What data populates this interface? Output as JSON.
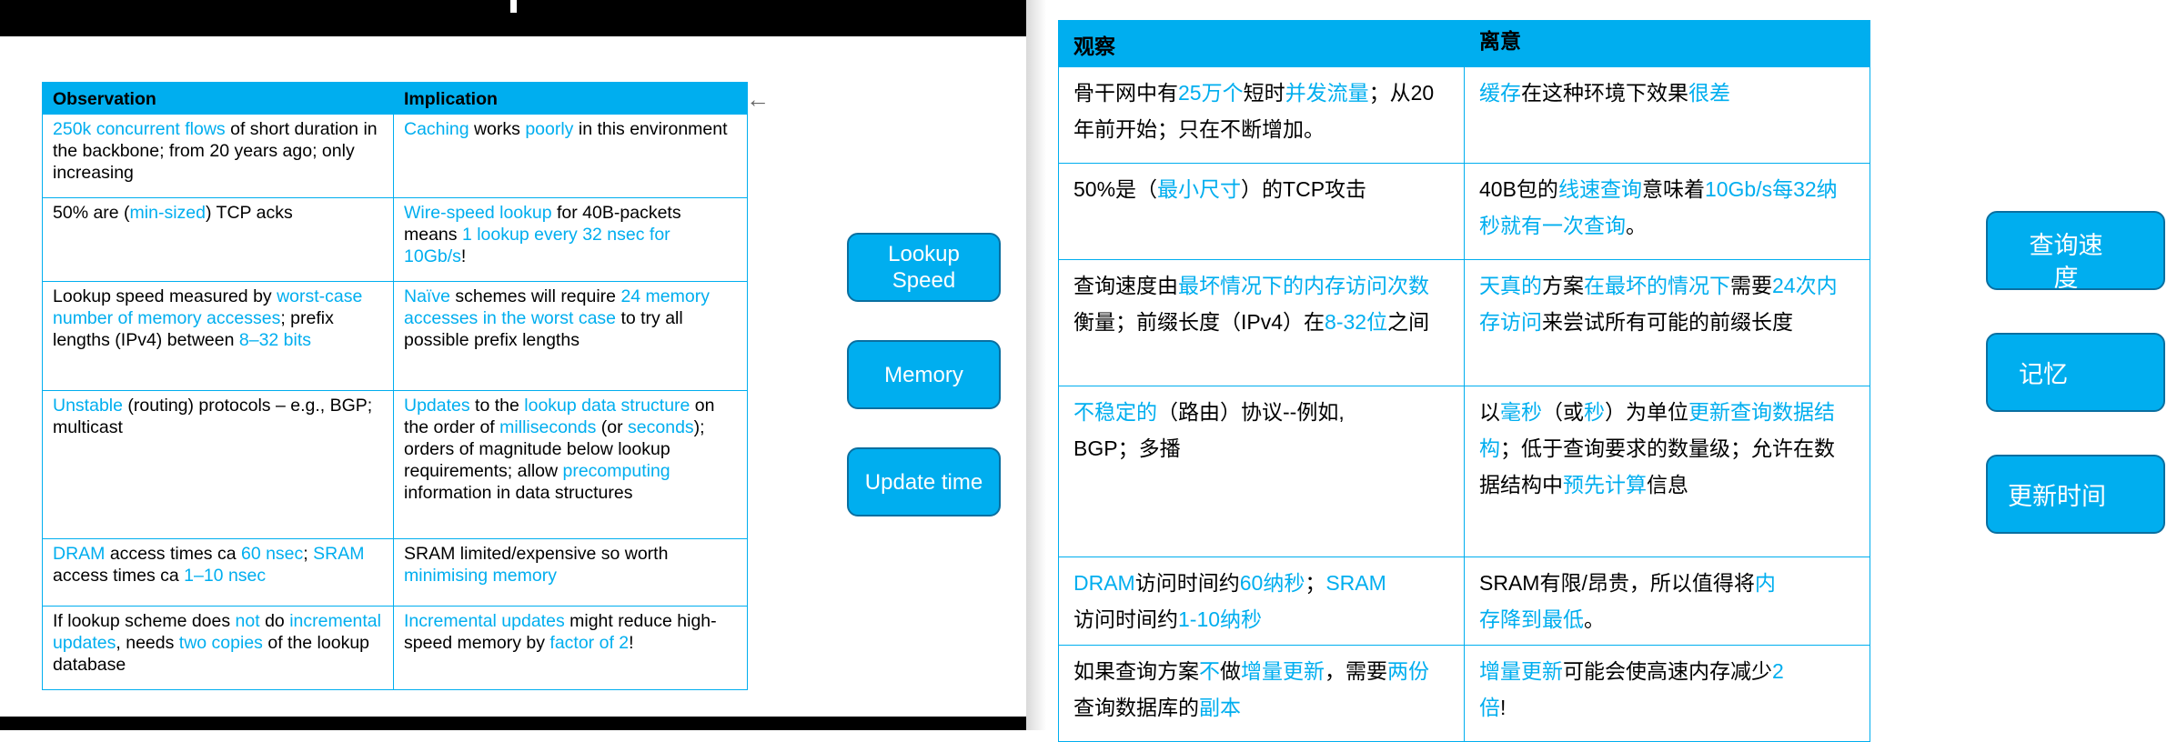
{
  "left_slide": {
    "headers": {
      "observation": "Observation",
      "implication": "Implication"
    },
    "rows": [
      {
        "obs": [
          {
            "t": "250k concurrent flows",
            "h": true
          },
          {
            "t": " of short duration in the backbone; from 20 years ago; only increasing",
            "h": false
          }
        ],
        "imp": [
          {
            "t": "Caching",
            "h": true
          },
          {
            "t": " works ",
            "h": false
          },
          {
            "t": "poorly",
            "h": true
          },
          {
            "t": " in this environment",
            "h": false
          }
        ]
      },
      {
        "obs": [
          {
            "t": "50% are (",
            "h": false
          },
          {
            "t": "min-sized",
            "h": true
          },
          {
            "t": ") TCP acks",
            "h": false
          }
        ],
        "imp": [
          {
            "t": "Wire-speed lookup",
            "h": true
          },
          {
            "t": " for 40B-packets means ",
            "h": false
          },
          {
            "t": "1 lookup every 32 nsec for 10Gb/s",
            "h": true
          },
          {
            "t": "!",
            "h": false
          }
        ]
      },
      {
        "obs": [
          {
            "t": "Lookup speed measured by ",
            "h": false
          },
          {
            "t": "worst-case number of memory accesses",
            "h": true
          },
          {
            "t": "; prefix lengths (IPv4) between ",
            "h": false
          },
          {
            "t": "8–32 bits",
            "h": true
          }
        ],
        "imp": [
          {
            "t": "Naïve",
            "h": true
          },
          {
            "t": " schemes will require ",
            "h": false
          },
          {
            "t": "24 memory accesses in the worst case",
            "h": true
          },
          {
            "t": " to try all possible prefix lengths",
            "h": false
          }
        ]
      },
      {
        "obs": [
          {
            "t": "Unstable",
            "h": true
          },
          {
            "t": " (routing) protocols – e.g., BGP; multicast",
            "h": false
          }
        ],
        "imp": [
          {
            "t": "Updates",
            "h": true
          },
          {
            "t": " to the ",
            "h": false
          },
          {
            "t": "lookup data structure",
            "h": true
          },
          {
            "t": " on the order of ",
            "h": false
          },
          {
            "t": "milliseconds",
            "h": true
          },
          {
            "t": " (or ",
            "h": false
          },
          {
            "t": "seconds",
            "h": true
          },
          {
            "t": "); orders of magnitude below lookup requirements; allow ",
            "h": false
          },
          {
            "t": "precomputing",
            "h": true
          },
          {
            "t": " information in data structures",
            "h": false
          }
        ]
      },
      {
        "obs": [
          {
            "t": "DRAM",
            "h": true
          },
          {
            "t": " access times ca ",
            "h": false
          },
          {
            "t": "60 nsec",
            "h": true
          },
          {
            "t": "; ",
            "h": false
          },
          {
            "t": "SRAM",
            "h": true
          },
          {
            "t": " access times ca ",
            "h": false
          },
          {
            "t": "1–10 nsec",
            "h": true
          }
        ],
        "imp": [
          {
            "t": "SRAM limited/expensive so worth ",
            "h": false
          },
          {
            "t": "minimising memory",
            "h": true
          }
        ]
      },
      {
        "obs": [
          {
            "t": "If lookup scheme does ",
            "h": false
          },
          {
            "t": "not",
            "h": true
          },
          {
            "t": " do ",
            "h": false
          },
          {
            "t": "incremental updates",
            "h": true
          },
          {
            "t": ", needs ",
            "h": false
          },
          {
            "t": "two copies",
            "h": true
          },
          {
            "t": " of the lookup database",
            "h": false
          }
        ],
        "imp": [
          {
            "t": "Incremental updates",
            "h": true
          },
          {
            "t": " might reduce high-speed memory by ",
            "h": false
          },
          {
            "t": "factor of 2",
            "h": true
          },
          {
            "t": "!",
            "h": false
          }
        ]
      }
    ],
    "buttons": {
      "lookup_speed": "Lookup Speed",
      "memory": "Memory",
      "update_time": "Update time"
    }
  },
  "right_slide": {
    "headers": {
      "observation": "观察",
      "implication": "离意"
    },
    "rows": [
      {
        "obs": [
          {
            "t": "骨干网中有",
            "h": false
          },
          {
            "t": "25万个",
            "h": true
          },
          {
            "t": "短时",
            "h": false
          },
          {
            "t": "并发流量",
            "h": true
          },
          {
            "t": "；从20年前开始；只在不断增加。",
            "h": false
          }
        ],
        "imp": [
          {
            "t": "缓存",
            "h": true
          },
          {
            "t": "在这种环境下效果",
            "h": false
          },
          {
            "t": "很差",
            "h": true
          }
        ]
      },
      {
        "obs": [
          {
            "t": "50%是（",
            "h": false
          },
          {
            "t": "最小尺寸",
            "h": true
          },
          {
            "t": "）的TCP攻击",
            "h": false
          }
        ],
        "imp": [
          {
            "t": "40B包的",
            "h": false
          },
          {
            "t": "线速查询",
            "h": true
          },
          {
            "t": "意味着",
            "h": false
          },
          {
            "t": "10Gb/s每32纳秒就有一次查询",
            "h": true
          },
          {
            "t": "。",
            "h": false
          }
        ]
      },
      {
        "obs": [
          {
            "t": "查询速度由",
            "h": false
          },
          {
            "t": "最坏情况下的内存访问次数",
            "h": true
          },
          {
            "t": "衡量；前缀长度（IPv4）在",
            "h": false
          },
          {
            "t": "8-32位",
            "h": true
          },
          {
            "t": "之间",
            "h": false
          }
        ],
        "imp": [
          {
            "t": "天真的",
            "h": true
          },
          {
            "t": "方案",
            "h": false
          },
          {
            "t": "在最坏的情况下",
            "h": true
          },
          {
            "t": "需要",
            "h": false
          },
          {
            "t": "24次内存访问",
            "h": true
          },
          {
            "t": "来尝试所有可能的前缀长度",
            "h": false
          }
        ]
      },
      {
        "obs": [
          {
            "t": "不稳定的",
            "h": true
          },
          {
            "t": "（路由）协议--例如,\nBGP；多播",
            "h": false
          }
        ],
        "imp": [
          {
            "t": "以",
            "h": false
          },
          {
            "t": "毫秒",
            "h": true
          },
          {
            "t": "（或",
            "h": false
          },
          {
            "t": "秒",
            "h": true
          },
          {
            "t": "）为单位",
            "h": false
          },
          {
            "t": "更新查询数据结构",
            "h": true
          },
          {
            "t": "；低于查询要求的数量级；允许在数据结构中",
            "h": false
          },
          {
            "t": "预先计算",
            "h": true
          },
          {
            "t": "信息",
            "h": false
          }
        ]
      },
      {
        "obs": [
          {
            "t": "DRAM",
            "h": true
          },
          {
            "t": "访问时间约",
            "h": false
          },
          {
            "t": "60纳秒",
            "h": true
          },
          {
            "t": "；",
            "h": false
          },
          {
            "t": "SRAM",
            "h": true
          },
          {
            "t": "\n访问时间约",
            "h": false
          },
          {
            "t": "1-10纳秒",
            "h": true
          }
        ],
        "imp": [
          {
            "t": "SRAM有限/昂贵，所以值得将",
            "h": false
          },
          {
            "t": "内\n存降到最低",
            "h": true
          },
          {
            "t": "。",
            "h": false
          }
        ]
      },
      {
        "obs": [
          {
            "t": "如果查询方案",
            "h": false
          },
          {
            "t": "不",
            "h": true
          },
          {
            "t": "做",
            "h": false
          },
          {
            "t": "增量更新",
            "h": true
          },
          {
            "t": "，需要",
            "h": false
          },
          {
            "t": "两份",
            "h": true
          },
          {
            "t": "查询数据库的",
            "h": false
          },
          {
            "t": "副本",
            "h": true
          }
        ],
        "imp": [
          {
            "t": "增量更新",
            "h": true
          },
          {
            "t": "可能会使高速内存减少",
            "h": false
          },
          {
            "t": "2\n倍",
            "h": true
          },
          {
            "t": "!",
            "h": false
          }
        ]
      }
    ],
    "buttons": {
      "lookup_speed": "查询速度",
      "memory": "记忆",
      "update_time": "更新时间"
    }
  }
}
